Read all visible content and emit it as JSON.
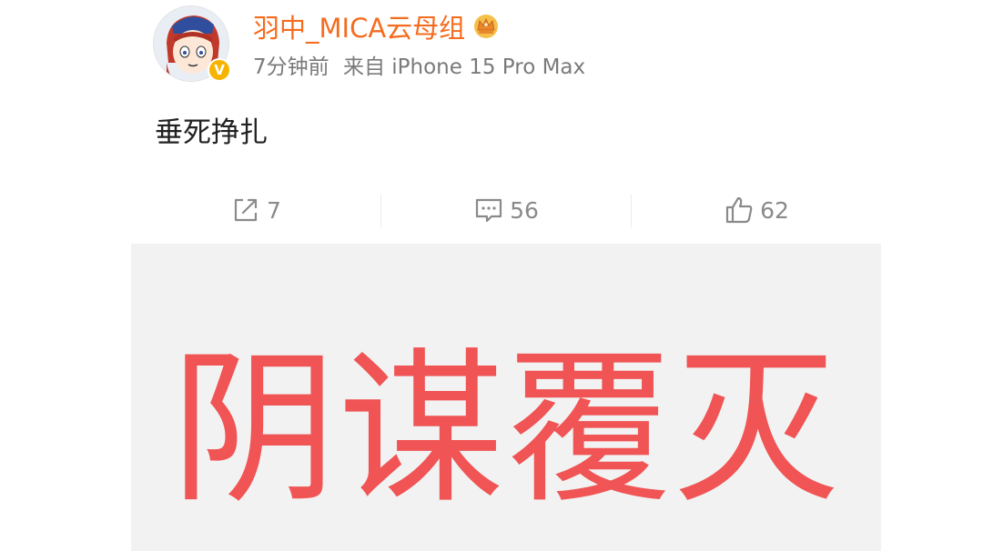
{
  "post": {
    "username": "羽中_MICA云母组",
    "time": "7分钟前",
    "source": "来自 iPhone 15 Pro Max",
    "text": "垂死挣扎",
    "verified_mark": "V"
  },
  "actions": {
    "repost_count": "7",
    "comment_count": "56",
    "like_count": "62"
  },
  "image": {
    "caption": "阴谋覆灭"
  },
  "colors": {
    "username": "#f56c1e",
    "image_text": "#f05454",
    "image_bg": "#f2f2f2",
    "badge": "#f6b400"
  },
  "icons": [
    "crown-icon",
    "repost-icon",
    "comment-icon",
    "like-icon"
  ]
}
